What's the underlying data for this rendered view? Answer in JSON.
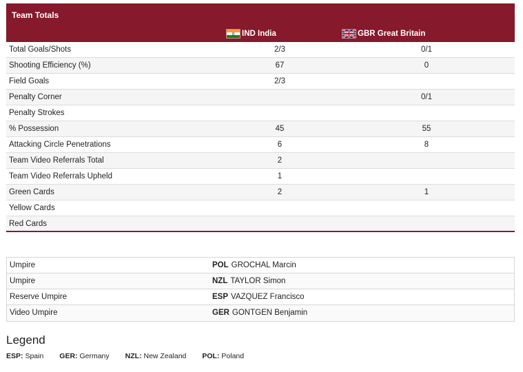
{
  "stats": {
    "title": "Team Totals",
    "team_ind": "IND India",
    "team_gbr": "GBR Great Britain",
    "rows": [
      {
        "label": "Total Goals/Shots",
        "ind": "2/3",
        "gbr": "0/1"
      },
      {
        "label": "Shooting Efficiency (%)",
        "ind": "67",
        "gbr": "0"
      },
      {
        "label": "Field Goals",
        "ind": "2/3",
        "gbr": ""
      },
      {
        "label": "Penalty Corner",
        "ind": "",
        "gbr": "0/1"
      },
      {
        "label": "Penalty Strokes",
        "ind": "",
        "gbr": ""
      },
      {
        "label": "% Possession",
        "ind": "45",
        "gbr": "55"
      },
      {
        "label": "Attacking Circle Penetrations",
        "ind": "6",
        "gbr": "8"
      },
      {
        "label": "Team Video Referrals Total",
        "ind": "2",
        "gbr": ""
      },
      {
        "label": "Team Video Referrals Upheld",
        "ind": "1",
        "gbr": ""
      },
      {
        "label": "Green Cards",
        "ind": "2",
        "gbr": "1"
      },
      {
        "label": "Yellow Cards",
        "ind": "",
        "gbr": ""
      },
      {
        "label": "Red Cards",
        "ind": "",
        "gbr": ""
      }
    ]
  },
  "officials": [
    {
      "role": "Umpire",
      "code": "POL",
      "name": "GROCHAL Marcin"
    },
    {
      "role": "Umpire",
      "code": "NZL",
      "name": "TAYLOR Simon"
    },
    {
      "role": "Reserve Umpire",
      "code": "ESP",
      "name": "VAZQUEZ Francisco"
    },
    {
      "role": "Video Umpire",
      "code": "GER",
      "name": "GONTGEN Benjamin"
    }
  ],
  "legend": {
    "title": "Legend",
    "items": [
      {
        "code": "ESP:",
        "name": "Spain"
      },
      {
        "code": "GER:",
        "name": "Germany"
      },
      {
        "code": "NZL:",
        "name": "New Zealand"
      },
      {
        "code": "POL:",
        "name": "Poland"
      }
    ]
  },
  "colors": {
    "header_bg": "#86192b",
    "accent": "#86192b"
  }
}
